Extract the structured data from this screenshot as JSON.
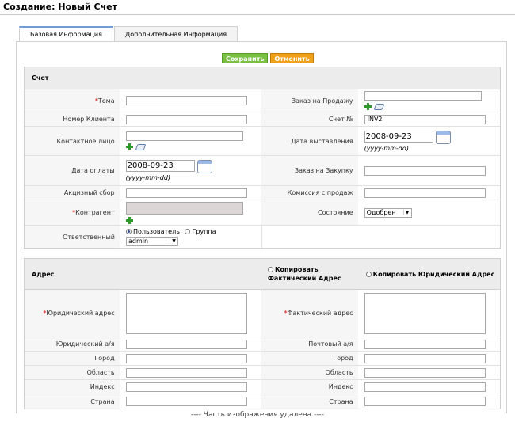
{
  "page": {
    "title": "Создание: Новый Счет",
    "footer_note": "---- Часть изображения удалена ----"
  },
  "tabs": [
    {
      "label": "Базовая Информация",
      "active": true
    },
    {
      "label": "Дополнительная Информация",
      "active": false
    }
  ],
  "actions": {
    "save": "Сохранить",
    "cancel": "Отменить"
  },
  "invoice_block": {
    "title": "Счет",
    "fields": {
      "subject": {
        "label": "Тема",
        "value": "",
        "required": true
      },
      "sales_order": {
        "label": "Заказ на Продажу",
        "value": ""
      },
      "customer_no": {
        "label": "Номер Клиента",
        "value": ""
      },
      "invoice_no": {
        "label": "Счет №",
        "value": "INV2"
      },
      "contact": {
        "label": "Контактное лицо",
        "value": ""
      },
      "invoice_date": {
        "label": "Дата выставления",
        "value": "2008-09-23",
        "hint": "(yyyy-mm-dd)"
      },
      "due_date": {
        "label": "Дата оплаты",
        "value": "2008-09-23",
        "hint": "(yyyy-mm-dd)"
      },
      "purchase_order": {
        "label": "Заказ на Закупку",
        "value": ""
      },
      "excise": {
        "label": "Акцизный сбор",
        "value": ""
      },
      "sales_commission": {
        "label": "Комиссия с продаж",
        "value": ""
      },
      "account": {
        "label": "Контрагент",
        "value": "",
        "required": true
      },
      "status": {
        "label": "Состояние",
        "value": "Одобрен"
      },
      "assigned": {
        "label": "Ответственный",
        "opt_user": "Пользователь",
        "opt_group": "Группа",
        "selected_user": "admin"
      }
    }
  },
  "address_block": {
    "title": "Адрес",
    "copy_shipping": "Копировать Фактический Адрес",
    "copy_billing": "Копировать Юридический Адрес",
    "fields": {
      "billing_address": {
        "label": "Юридический адрес",
        "required": true
      },
      "shipping_address": {
        "label": "Фактический адрес",
        "required": true
      },
      "billing_pobox": {
        "label": "Юридический а/я"
      },
      "shipping_pobox": {
        "label": "Почтовый а/я"
      },
      "billing_city": {
        "label": "Город"
      },
      "shipping_city": {
        "label": "Город"
      },
      "billing_state": {
        "label": "Область"
      },
      "shipping_state": {
        "label": "Область"
      },
      "billing_code": {
        "label": "Индекс"
      },
      "shipping_code": {
        "label": "Индекс"
      },
      "billing_country": {
        "label": "Страна"
      },
      "shipping_country": {
        "label": "Страна"
      }
    }
  }
}
